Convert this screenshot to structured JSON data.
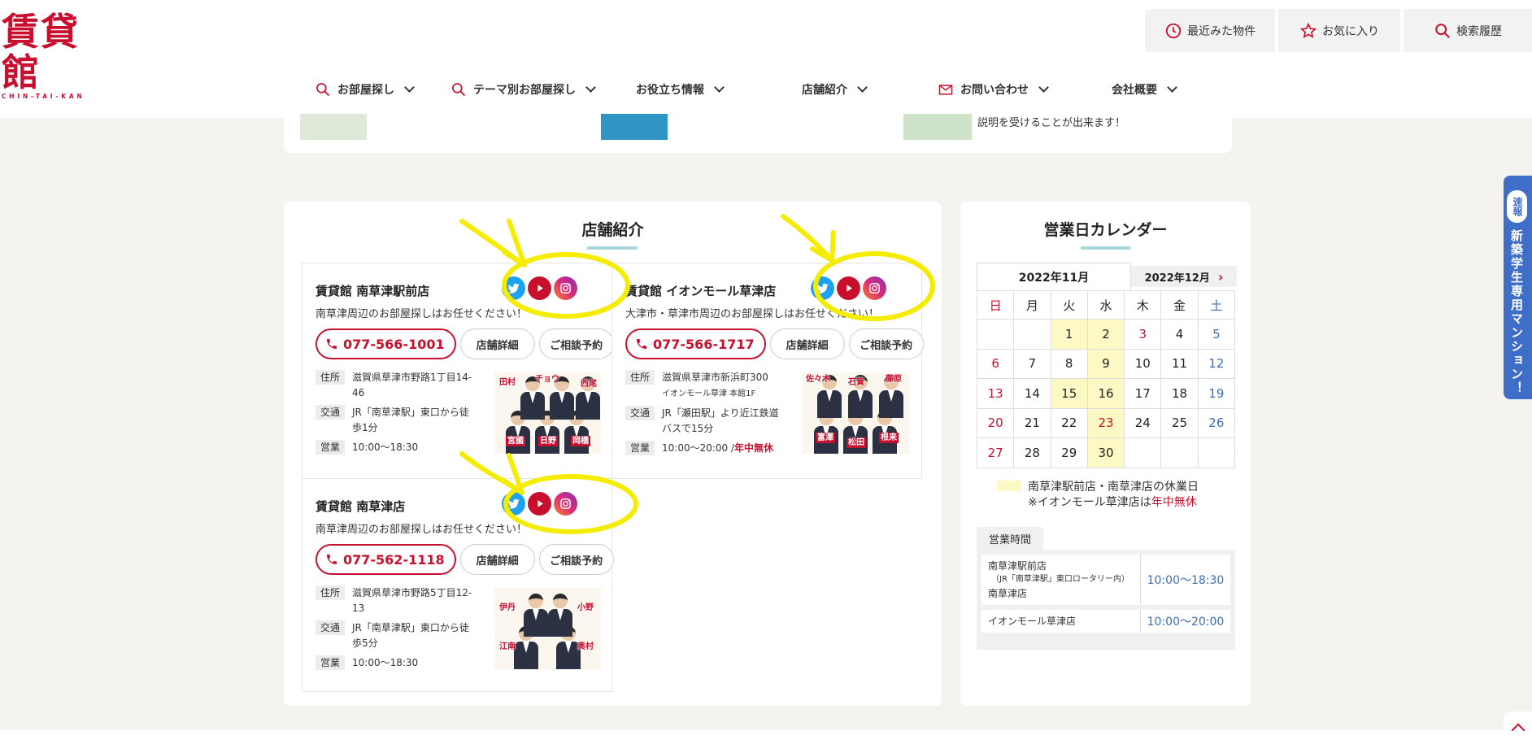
{
  "header": {
    "logo_text": "賃貸館",
    "logo_sub": "CHIN-TAI-KAN",
    "top_buttons": [
      {
        "label": "最近みた物件",
        "icon": "clock-icon"
      },
      {
        "label": "お気に入り",
        "icon": "star-icon"
      },
      {
        "label": "検索履歴",
        "icon": "search-icon"
      }
    ],
    "nav": [
      {
        "label": "お部屋探し",
        "icon": "search-icon"
      },
      {
        "label": "テーマ別お部屋探し",
        "icon": "search-icon"
      },
      {
        "label": "お役立ち情報"
      },
      {
        "label": "店舗紹介"
      },
      {
        "label": "お問い合わせ",
        "icon": "mail-icon"
      },
      {
        "label": "会社概要"
      }
    ]
  },
  "strip": {
    "text": "説明を受けることが出来ます！"
  },
  "shops": {
    "title": "店舗紹介",
    "cards": [
      {
        "name": "賃貸館 南草津駅前店",
        "desc": "南草津周辺のお部屋探しはお任せください！",
        "tel": "077-566-1001",
        "detail_label": "店舗詳細",
        "consult_label": "ご相談予約",
        "address_label": "住所",
        "address": "滋賀県草津市野路1丁目14-46",
        "access_label": "交通",
        "access": "JR「南草津駅」東口から徒歩1分",
        "hours_label": "営業",
        "hours": "10:00～18:30",
        "staff": [
          "田村",
          "チョウ",
          "西尾",
          "宮國",
          "日野",
          "岡橋"
        ]
      },
      {
        "name": "賃貸館 イオンモール草津店",
        "desc": "大津市・草津市周辺のお部屋探しはお任せください！",
        "tel": "077-566-1717",
        "detail_label": "店舗詳細",
        "consult_label": "ご相談予約",
        "address_label": "住所",
        "address": "滋賀県草津市新浜町300",
        "address2": "イオンモール草津 本館1F",
        "access_label": "交通",
        "access": "JR「瀬田駅」より近江鉄道バスで15分",
        "hours_label": "営業",
        "hours": "10:00～20:00 /",
        "hours_note": "年中無休",
        "staff": [
          "佐々木",
          "石賀",
          "藤原",
          "富澤",
          "松田",
          "根来"
        ]
      },
      {
        "name": "賃貸館 南草津店",
        "desc": "南草津周辺のお部屋探しはお任せください！",
        "tel": "077-562-1118",
        "detail_label": "店舗詳細",
        "consult_label": "ご相談予約",
        "address_label": "住所",
        "address": "滋賀県草津市野路5丁目12-13",
        "access_label": "交通",
        "access": "JR「南草津駅」東口から徒歩5分",
        "hours_label": "営業",
        "hours": "10:00～18:30",
        "staff": [
          "伊丹",
          "小野",
          "江南",
          "奥村"
        ]
      }
    ]
  },
  "calendar": {
    "title": "営業日カレンダー",
    "tab_current": "2022年11月",
    "tab_next": "2022年12月",
    "weekdays": [
      "日",
      "月",
      "火",
      "水",
      "木",
      "金",
      "土"
    ],
    "weeks": [
      [
        "",
        "",
        "1",
        "2",
        "3",
        "4",
        "5"
      ],
      [
        "6",
        "7",
        "8",
        "9",
        "10",
        "11",
        "12"
      ],
      [
        "13",
        "14",
        "15",
        "16",
        "17",
        "18",
        "19"
      ],
      [
        "20",
        "21",
        "22",
        "23",
        "24",
        "25",
        "26"
      ],
      [
        "27",
        "28",
        "29",
        "30",
        "",
        "",
        ""
      ]
    ],
    "closed_days": [
      "1",
      "2",
      "9",
      "15",
      "16",
      "23",
      "30"
    ],
    "holiday_days": [
      "3",
      "23"
    ],
    "legend1": "南草津駅前店・南草津店の休業日",
    "legend2_prefix": "※イオンモール草津店は",
    "legend2_red": "年中無休",
    "hours_tab": "営業時間",
    "hours": [
      {
        "name": "南草津駅前店",
        "sub": "（JR「南草津駅」東口ロータリー内）",
        "name2": "南草津店",
        "time": "10:00～18:30"
      },
      {
        "name": "イオンモール草津店",
        "time": "10:00～20:00"
      }
    ]
  },
  "side_banner": {
    "badge": "速報",
    "text": "新築学生専用マンション！"
  },
  "colors": {
    "brand_red": "#c8102e",
    "accent_teal": "#a8d8dc",
    "closed_yellow": "#fdf9c4",
    "sat_blue": "#3b6fb6",
    "annotation_yellow": "#f5ec00"
  }
}
